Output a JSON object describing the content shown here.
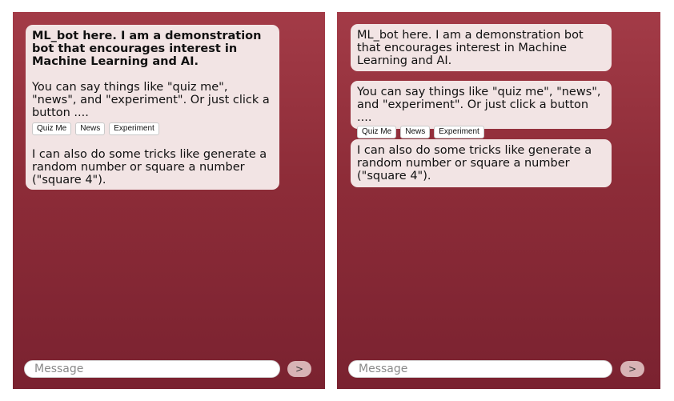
{
  "left_panel": {
    "intro": "ML_bot here. I am a demonstration bot that encourages interest in Machine Learning and AI.",
    "hint": "You can say things like \"quiz me\", \"news\", and \"experiment\". Or just click a button ....",
    "buttons": [
      "Quiz Me",
      "News",
      "Experiment"
    ],
    "tricks": "I can also do some tricks like generate a random number or square a number (\"square 4\").",
    "input_placeholder": "Message",
    "send_label": ">"
  },
  "right_panel": {
    "intro": "ML_bot here. I am a demonstration bot that encourages interest in Machine Learning and AI.",
    "hint": "You can say things like \"quiz me\", \"news\", and \"experiment\". Or just click a button ....",
    "buttons": [
      "Quiz Me",
      "News",
      "Experiment"
    ],
    "tricks": "I can also do some tricks like generate a random number or square a number (\"square 4\").",
    "input_placeholder": "Message",
    "send_label": ">"
  },
  "colors": {
    "panel_top": "#a33b47",
    "panel_bottom": "#7a2230",
    "bubble": "#f2e4e4",
    "send_button": "#d8b3b5"
  }
}
